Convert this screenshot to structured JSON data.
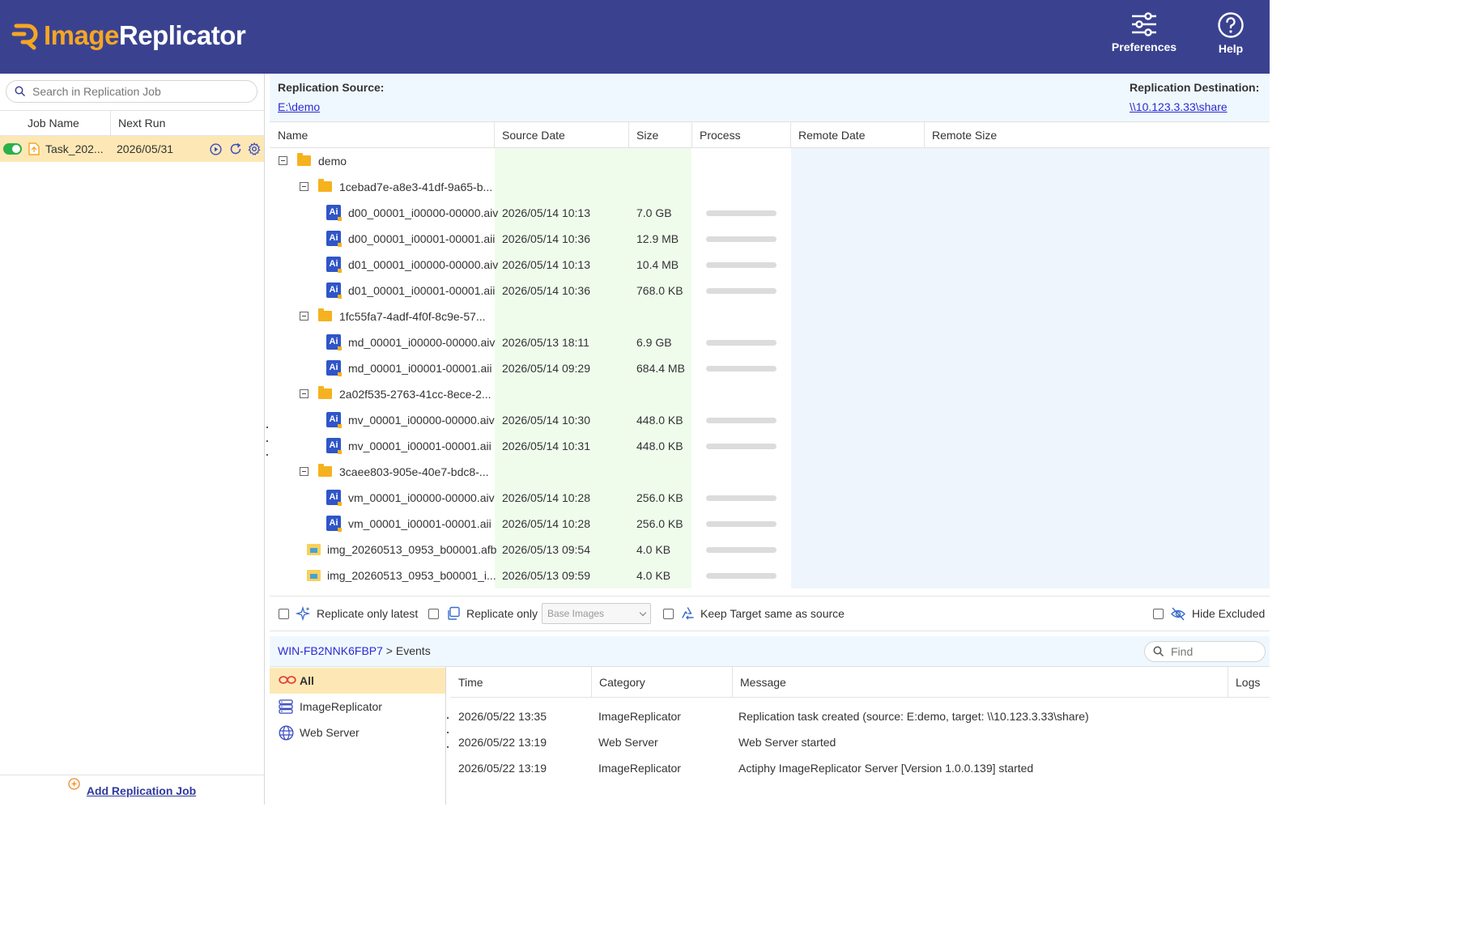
{
  "app": {
    "logo_part1": "Image",
    "logo_part2": "Replicator",
    "preferences_label": "Preferences",
    "help_label": "Help",
    "colors": {
      "header": "#3a4290",
      "accent": "#f5a623",
      "selected_row": "#fde8b5",
      "link": "#2a2ad0"
    }
  },
  "left_panel": {
    "search_placeholder": "Search in Replication Job",
    "columns": {
      "job_name": "Job Name",
      "next_run": "Next Run"
    },
    "jobs": [
      {
        "enabled": true,
        "name": "Task_202...",
        "next_run": "2026/05/31"
      }
    ],
    "add_job_label": "Add Replication Job"
  },
  "replication": {
    "source_label": "Replication Source:",
    "source_path": "E:\\demo",
    "destination_label": "Replication Destination:",
    "destination_path": "\\\\10.123.3.33\\share"
  },
  "file_table": {
    "columns": {
      "name": "Name",
      "source_date": "Source Date",
      "size": "Size",
      "process": "Process",
      "remote_date": "Remote Date",
      "remote_size": "Remote Size"
    },
    "rows": [
      {
        "type": "folder",
        "level": 0,
        "name": "demo",
        "date": "",
        "size": ""
      },
      {
        "type": "folder",
        "level": 1,
        "name": "1cebad7e-a8e3-41df-9a65-b...",
        "date": "",
        "size": ""
      },
      {
        "type": "ai",
        "level": 2,
        "name": "d00_00001_i00000-00000.aiv",
        "date": "2026/05/14 10:13",
        "size": "7.0 GB"
      },
      {
        "type": "ai",
        "level": 2,
        "name": "d00_00001_i00001-00001.aii",
        "date": "2026/05/14 10:36",
        "size": "12.9 MB"
      },
      {
        "type": "ai",
        "level": 2,
        "name": "d01_00001_i00000-00000.aiv",
        "date": "2026/05/14 10:13",
        "size": "10.4 MB"
      },
      {
        "type": "ai",
        "level": 2,
        "name": "d01_00001_i00001-00001.aii",
        "date": "2026/05/14 10:36",
        "size": "768.0 KB"
      },
      {
        "type": "folder",
        "level": 1,
        "name": "1fc55fa7-4adf-4f0f-8c9e-57...",
        "date": "",
        "size": ""
      },
      {
        "type": "ai",
        "level": 2,
        "name": "md_00001_i00000-00000.aiv",
        "date": "2026/05/13 18:11",
        "size": "6.9 GB"
      },
      {
        "type": "ai",
        "level": 2,
        "name": "md_00001_i00001-00001.aii",
        "date": "2026/05/14 09:29",
        "size": "684.4 MB"
      },
      {
        "type": "folder",
        "level": 1,
        "name": "2a02f535-2763-41cc-8ece-2...",
        "date": "",
        "size": ""
      },
      {
        "type": "ai",
        "level": 2,
        "name": "mv_00001_i00000-00000.aiv",
        "date": "2026/05/14 10:30",
        "size": "448.0 KB"
      },
      {
        "type": "ai",
        "level": 2,
        "name": "mv_00001_i00001-00001.aii",
        "date": "2026/05/14 10:31",
        "size": "448.0 KB"
      },
      {
        "type": "folder",
        "level": 1,
        "name": "3caee803-905e-40e7-bdc8-...",
        "date": "",
        "size": ""
      },
      {
        "type": "ai",
        "level": 2,
        "name": "vm_00001_i00000-00000.aiv",
        "date": "2026/05/14 10:28",
        "size": "256.0 KB"
      },
      {
        "type": "ai",
        "level": 2,
        "name": "vm_00001_i00001-00001.aii",
        "date": "2026/05/14 10:28",
        "size": "256.0 KB"
      },
      {
        "type": "afb",
        "level": 1,
        "name": "img_20260513_0953_b00001.afb",
        "date": "2026/05/13 09:54",
        "size": "4.0 KB"
      },
      {
        "type": "afb",
        "level": 1,
        "name": "img_20260513_0953_b00001_i...",
        "date": "2026/05/13 09:59",
        "size": "4.0 KB"
      }
    ]
  },
  "options": {
    "replicate_latest": "Replicate only latest",
    "replicate_only": "Replicate only",
    "replicate_only_select": "Base Images",
    "keep_target": "Keep Target same as source",
    "hide_excluded": "Hide Excluded"
  },
  "events": {
    "host": "WIN-FB2NNK6FBP7",
    "crumb_sep": " > ",
    "section": "Events",
    "find_placeholder": "Find",
    "filters": [
      {
        "label": "All",
        "icon": "infinity-icon"
      },
      {
        "label": "ImageReplicator",
        "icon": "server-icon"
      },
      {
        "label": "Web Server",
        "icon": "globe-icon"
      }
    ],
    "columns": {
      "time": "Time",
      "category": "Category",
      "message": "Message",
      "logs": "Logs"
    },
    "rows": [
      {
        "time": "2026/05/22 13:35",
        "category": "ImageReplicator",
        "message": "Replication task created (source: E:demo, target: \\\\10.123.3.33\\share)"
      },
      {
        "time": "2026/05/22 13:19",
        "category": "Web Server",
        "message": "Web Server started"
      },
      {
        "time": "2026/05/22 13:19",
        "category": "ImageReplicator",
        "message": "Actiphy ImageReplicator Server [Version 1.0.0.139] started"
      }
    ]
  }
}
